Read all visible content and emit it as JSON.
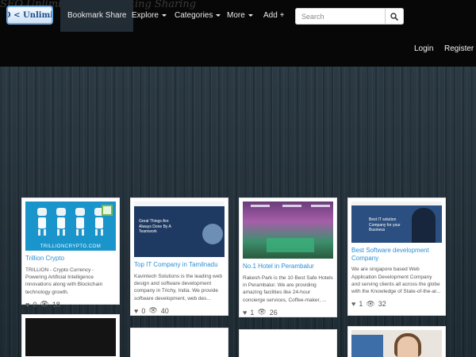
{
  "site": {
    "tagline": "SEO Unlimited Bookmarking Sharing",
    "logo_text": "SEO < Unlimited"
  },
  "nav": {
    "items": [
      {
        "label": "Bookmark Share",
        "active": true,
        "caret": false
      },
      {
        "label": "Explore",
        "caret": true
      },
      {
        "label": "Categories",
        "caret": true
      },
      {
        "label": "More",
        "caret": true
      },
      {
        "label": "Add +",
        "caret": false
      }
    ],
    "search_placeholder": "Search",
    "login": "Login",
    "register": "Register"
  },
  "cards": [
    {
      "title": "Trillion Crypto",
      "image_caption": "TRILLIONCRYPTO.COM",
      "description": "TRILLION - Crypto Currency - Powering Artificial Intelligence innovations along with Blockchain technology growth.",
      "likes": "0",
      "views": "18"
    },
    {
      "title": "Top IT Company in Tamilnadu",
      "image_text": "Great Things Are Always Done By A Teamwork",
      "description": "Kavintech Solutions is the leading web design and software development company in Trichy, India. We provide software development, web des...",
      "likes": "0",
      "views": "40"
    },
    {
      "title": "No.1 Hotel in Perambalur",
      "description": "Rakesh Park is the 10 Best Safe Hotels in Perambalur. We are providing amazing facilities like 24-hour concierge services, Coffee-maker, ...",
      "likes": "1",
      "views": "26"
    },
    {
      "title": "Best Software development Company",
      "image_text": "Best IT solution Company for your Business",
      "description": "We are singapore based Web Application Development Company and serving clients all across the globe with the Knowledge of State-of-the-ar...",
      "likes": "1",
      "views": "32"
    }
  ],
  "icons": {
    "search": "search-icon",
    "heart": "heart-icon",
    "eye": "eye-icon"
  }
}
